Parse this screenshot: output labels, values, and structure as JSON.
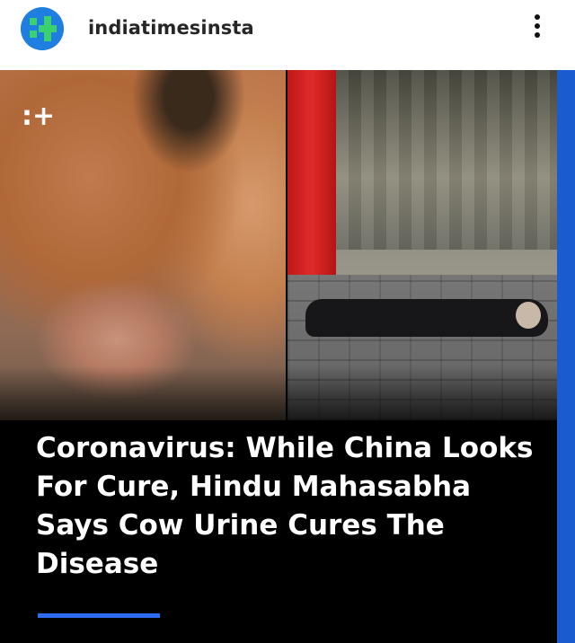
{
  "post": {
    "username": "indiatimesinsta",
    "more_icon": "more-vertical-icon",
    "avatar_icon": "indiatimes-logo-icon"
  },
  "media": {
    "logo_mark": ":+",
    "headline": "Coronavirus: While China Looks For Cure, Hindu Mahasabha Says Cow Urine Cures The Disease",
    "accent_color": "#2d6bf0",
    "side_bar_color": "#1a5bd0"
  }
}
